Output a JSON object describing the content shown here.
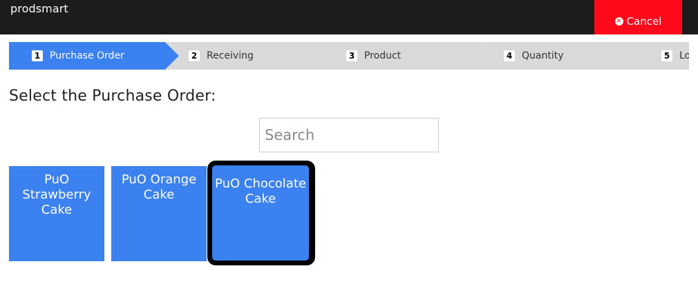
{
  "app": {
    "brand": "prodsmart",
    "cancel_label": "Cancel",
    "colors": {
      "topbar": "#1c1c1c",
      "cancel": "#ff0a1a",
      "accent": "#3b82f0",
      "step_inactive": "#d9d9d9"
    }
  },
  "wizard": {
    "steps": [
      {
        "num": "1",
        "label": "Purchase Order",
        "active": true
      },
      {
        "num": "2",
        "label": "Receiving",
        "active": false
      },
      {
        "num": "3",
        "label": "Product",
        "active": false
      },
      {
        "num": "4",
        "label": "Quantity",
        "active": false
      },
      {
        "num": "5",
        "label": "Lo",
        "active": false
      }
    ]
  },
  "main": {
    "heading": "Select the Purchase Order:",
    "search_placeholder": "Search",
    "search_value": "",
    "orders": [
      {
        "label": "PuO Strawberry Cake",
        "selected": false
      },
      {
        "label": "PuO Orange Cake",
        "selected": false
      },
      {
        "label": "PuO Chocolate Cake",
        "selected": true
      }
    ]
  }
}
